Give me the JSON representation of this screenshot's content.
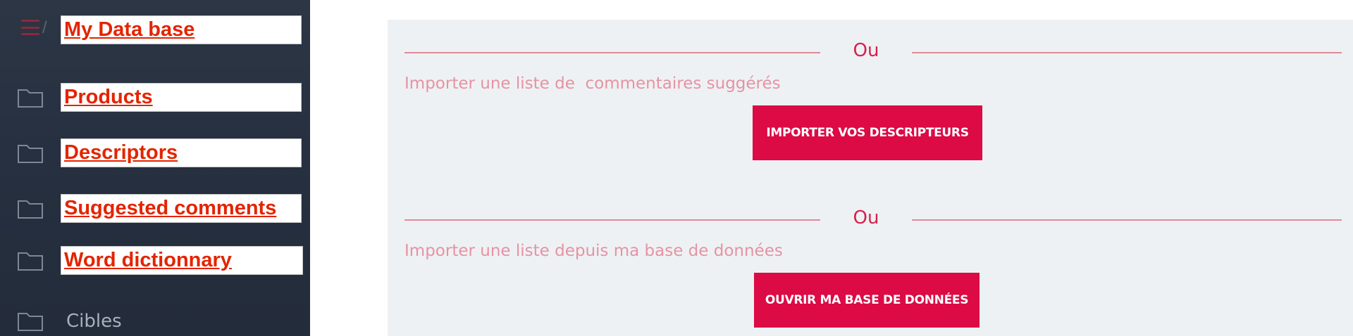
{
  "sidebar": {
    "breadcrumb_separator": "/",
    "items": [
      {
        "label": "My Data base",
        "style": "link"
      },
      {
        "label": "Products",
        "style": "link"
      },
      {
        "label": "Descriptors",
        "style": "link"
      },
      {
        "label": "Suggested comments",
        "style": "link"
      },
      {
        "label": "Word dictionnary",
        "style": "link"
      },
      {
        "label": "Cibles",
        "style": "plain"
      }
    ]
  },
  "main": {
    "sections": [
      {
        "divider_text": "Ou",
        "instruction": "Importer une liste de  commentaires suggérés",
        "button_label": "IMPORTER VOS DESCRIPTEURS"
      },
      {
        "divider_text": "Ou",
        "instruction": "Importer une liste depuis ma base de données",
        "button_label": "OUVRIR MA BASE DE DONNÉES"
      }
    ]
  },
  "colors": {
    "sidebar_bg": "#263040",
    "accent": "#dc0a45",
    "link_red": "#e32400",
    "panel_bg": "#eef1f4"
  }
}
